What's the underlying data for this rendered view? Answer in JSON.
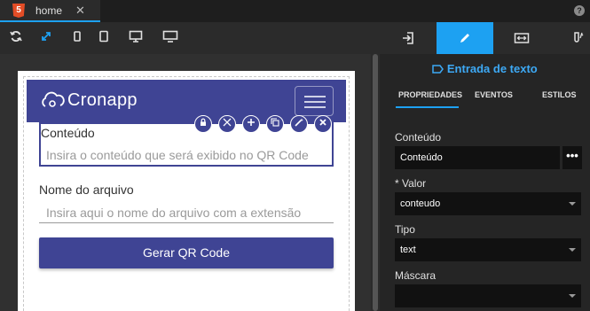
{
  "tab": {
    "title": "home",
    "close": "✕",
    "badge": "5"
  },
  "help": "?",
  "toolbar": {
    "icons": [
      "refresh-icon",
      "expand-icon",
      "mobile-icon",
      "tablet-icon",
      "desktop-icon",
      "monitor-icon"
    ]
  },
  "app": {
    "brand": "Cronapp",
    "field1_label": "Conteúdo",
    "field1_placeholder": "Insira o conteúdo que será exibido no QR Code",
    "field2_label": "Nome do arquivo",
    "field2_placeholder": "Insira aqui o nome do arquivo com a extensão",
    "button_label": "Gerar QR Code"
  },
  "panel": {
    "title": "Entrada de texto",
    "subtabs": [
      "PROPRIEDADES",
      "EVENTOS",
      "ESTILOS"
    ],
    "fields": [
      {
        "label": "Conteúdo",
        "value": "Conteúdo"
      },
      {
        "label": "* Valor",
        "value": "conteudo"
      },
      {
        "label": "Tipo",
        "value": "text"
      },
      {
        "label": "Máscara",
        "value": ""
      }
    ],
    "more": "•••"
  },
  "colors": {
    "brand": "#3f4494",
    "accent": "#1da1f2"
  }
}
